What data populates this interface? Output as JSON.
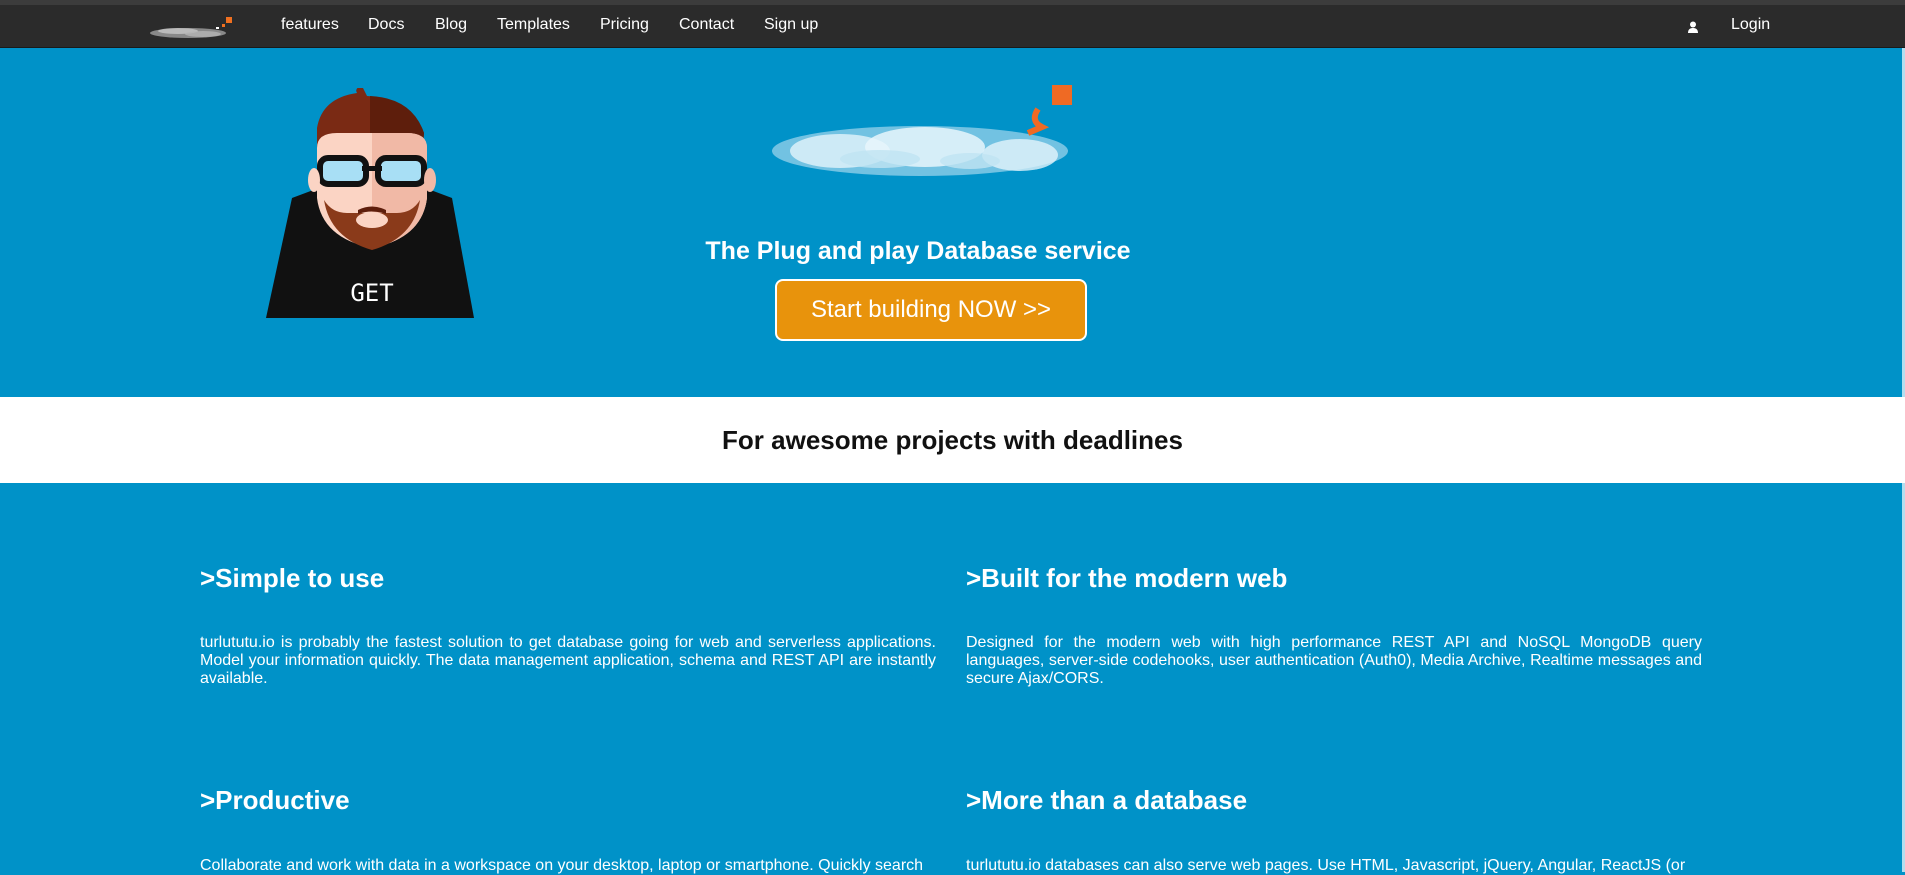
{
  "nav": {
    "links": [
      "features",
      "Docs",
      "Blog",
      "Templates",
      "Pricing",
      "Contact",
      "Sign up"
    ],
    "login": "Login",
    "logo_icon": "turlututu-logo",
    "user_icon": "user-icon"
  },
  "hero": {
    "avatar_shirt_text": "GET",
    "tagline": "The Plug and play Database service",
    "cta_label": "Start building NOW >>",
    "cta_color": "#e8930c",
    "background_color": "#0092c8"
  },
  "band": {
    "heading": "For awesome projects with deadlines"
  },
  "features": [
    {
      "title": ">Simple to use",
      "text": "turlututu.io is probably the fastest solution to get database going for web and serverless applications. Model your information quickly. The data management application, schema and REST API are instantly available."
    },
    {
      "title": ">Built for the modern web",
      "text": "Designed for the modern web with high performance REST API and NoSQL MongoDB query languages, server-side codehooks, user authentication (Auth0), Media Archive, Realtime messages and secure Ajax/CORS."
    },
    {
      "title": ">Productive",
      "text": "Collaborate and work with data in a workspace on your desktop, laptop or smartphone. Quickly search"
    },
    {
      "title": ">More than a database",
      "text": "turlututu.io databases can also serve web pages. Use HTML, Javascript, jQuery, Angular, ReactJS (or"
    }
  ]
}
